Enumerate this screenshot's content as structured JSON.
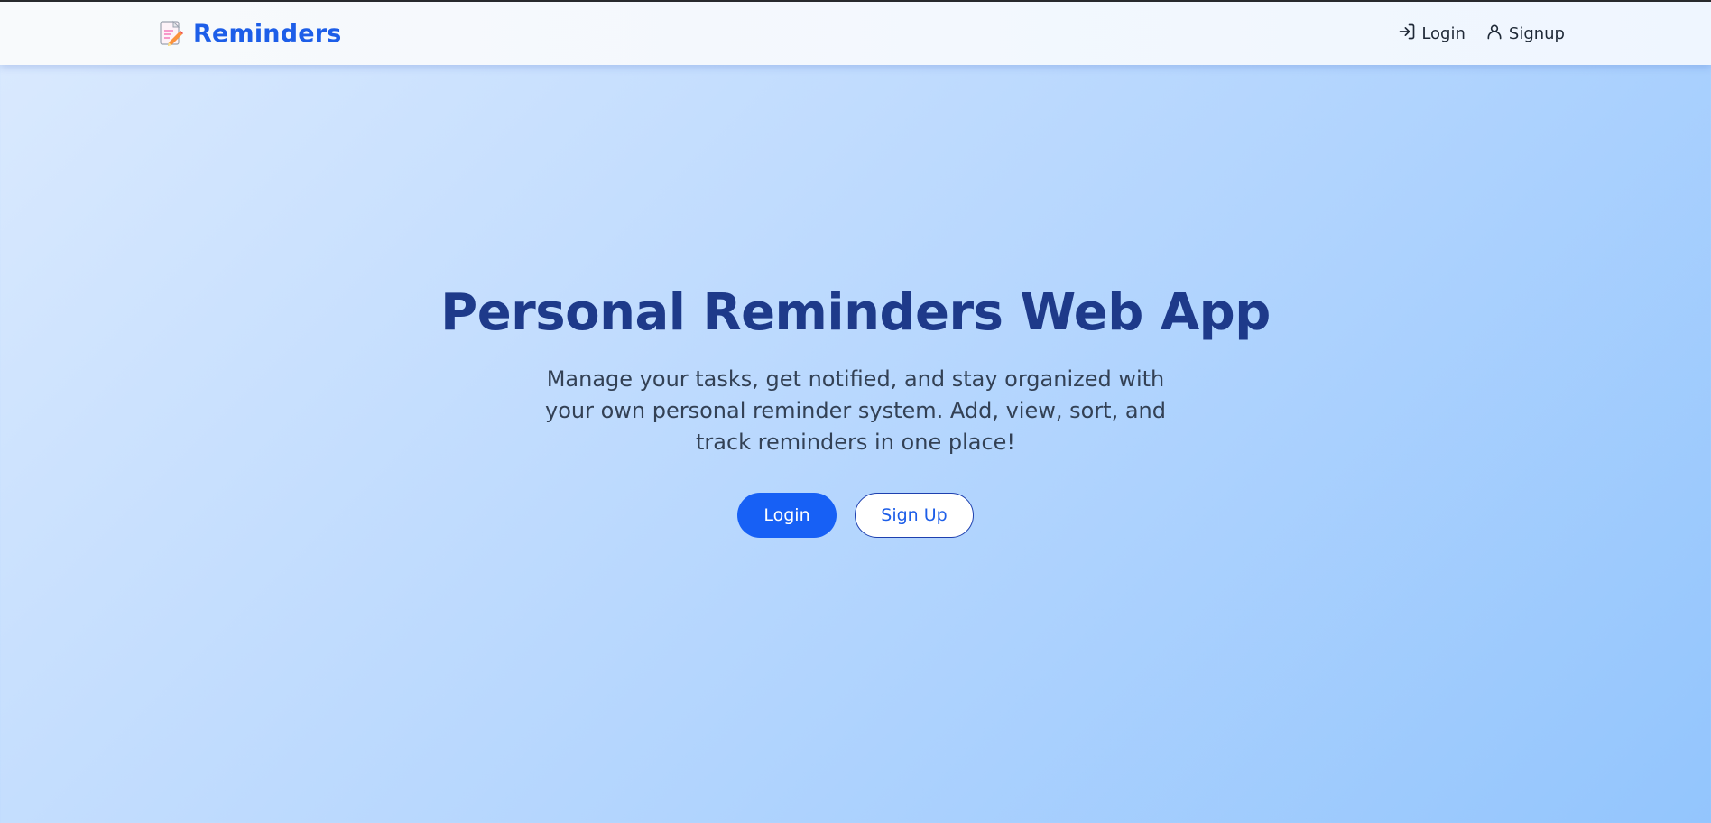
{
  "navbar": {
    "brand": "Reminders",
    "brand_icon": "memo-icon",
    "links": [
      {
        "label": "Login",
        "icon": "login-icon"
      },
      {
        "label": "Signup",
        "icon": "user-icon"
      }
    ]
  },
  "hero": {
    "title": "Personal Reminders Web App",
    "subtitle": "Manage your tasks, get notified, and stay organized with your own personal reminder system. Add, view, sort, and track reminders in one place!",
    "primary_button": "Login",
    "secondary_button": "Sign Up"
  },
  "colors": {
    "brand": "#1d5ee8",
    "title": "#1e3a8a",
    "primary_button": "#1760f5"
  }
}
